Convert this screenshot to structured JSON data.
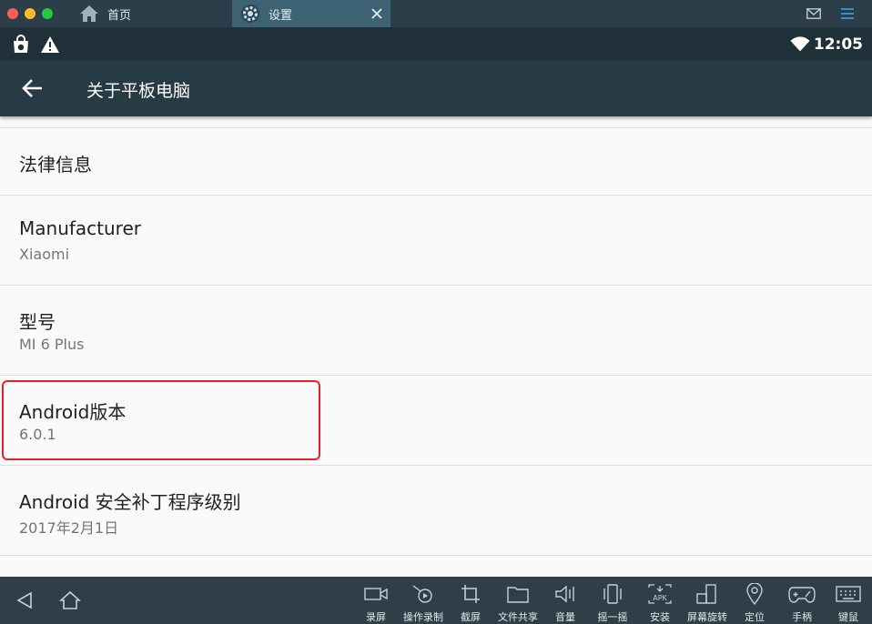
{
  "window": {
    "tabs": [
      {
        "label": "首页",
        "icon": "home-icon"
      },
      {
        "label": "设置",
        "icon": "gear-icon"
      }
    ]
  },
  "status": {
    "time": "12:05"
  },
  "actionbar": {
    "title": "关于平板电脑"
  },
  "items": [
    {
      "title": "法律信息",
      "subtitle": ""
    },
    {
      "title": "Manufacturer",
      "subtitle": "Xiaomi"
    },
    {
      "title": "型号",
      "subtitle": "MI 6 Plus"
    },
    {
      "title": "Android版本",
      "subtitle": "6.0.1"
    },
    {
      "title": "Android 安全补丁程序级别",
      "subtitle": "2017年2月1日"
    }
  ],
  "toolbar": {
    "tools": [
      {
        "label": "录屏",
        "icon": "video-camera-icon"
      },
      {
        "label": "操作录制",
        "icon": "record-operation-icon"
      },
      {
        "label": "截屏",
        "icon": "crop-icon"
      },
      {
        "label": "文件共享",
        "icon": "folder-icon"
      },
      {
        "label": "音量",
        "icon": "volume-icon"
      },
      {
        "label": "摇一摇",
        "icon": "shake-phone-icon"
      },
      {
        "label": "安装",
        "icon": "apk-install-icon"
      },
      {
        "label": "屏幕旋转",
        "icon": "rotate-screen-icon"
      },
      {
        "label": "定位",
        "icon": "location-pin-icon"
      },
      {
        "label": "手柄",
        "icon": "gamepad-icon"
      },
      {
        "label": "键鼠",
        "icon": "keyboard-icon"
      }
    ]
  },
  "colors": {
    "titlebar": "#2c3e4a",
    "active_tab": "#3d6273",
    "statusbar": "#1f3039",
    "actionbar": "#263b44",
    "highlight": "#e8202a",
    "bottombar": "#2f3f48"
  }
}
